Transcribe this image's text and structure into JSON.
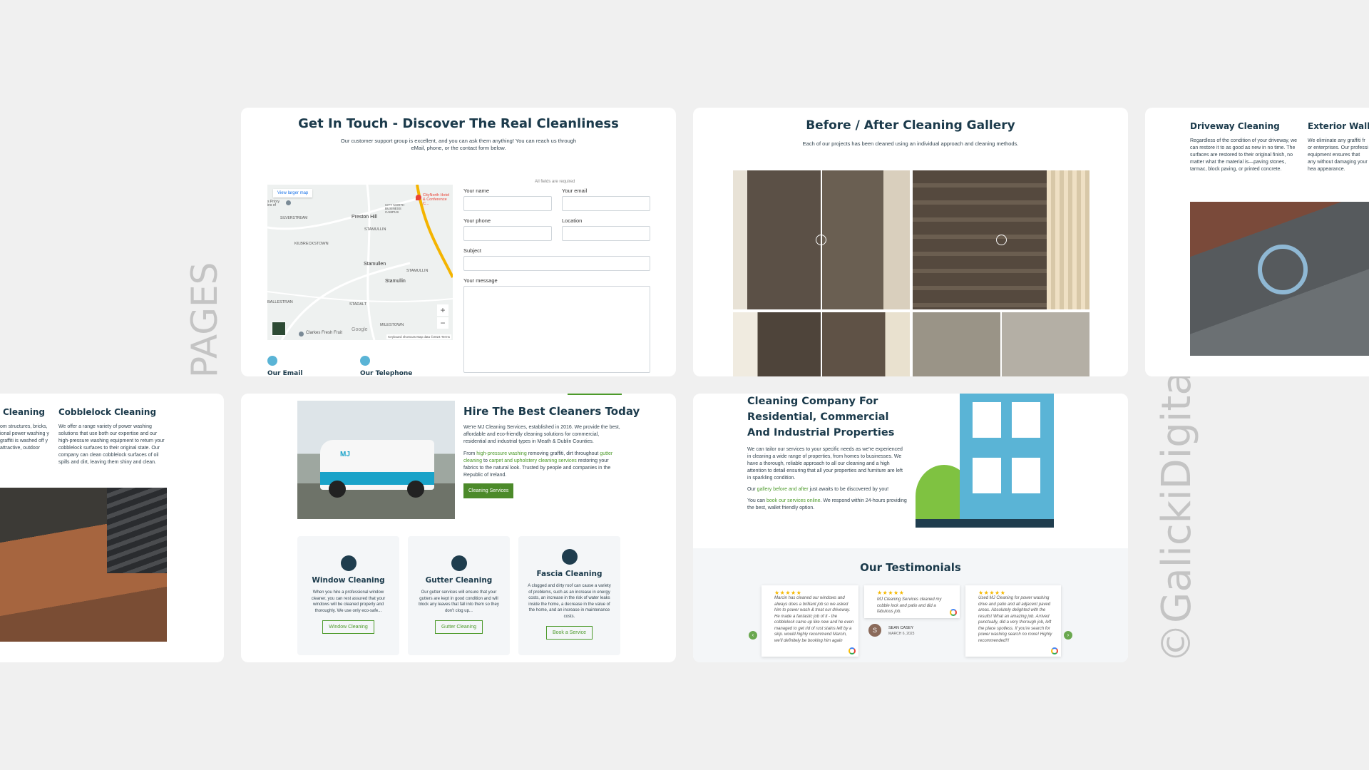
{
  "labels": {
    "pages": "PAGES",
    "watermark": "©GalickiDigital"
  },
  "contact": {
    "title": "Get In Touch - Discover The Real Cleanliness",
    "intro": "Our customer support group is excellent, and you can ask them anything! You can reach us through eMail, phone, or the contact form below.",
    "required_note": "All fields are required",
    "fields": {
      "name": "Your name",
      "email": "Your email",
      "phone": "Your phone",
      "location": "Location",
      "subject": "Subject",
      "message": "Your message"
    },
    "map": {
      "view_larger": "View larger map",
      "poi": "CityNorth Hotel & Conference C...",
      "places": [
        "Preston Hill",
        "STAMULLIN",
        "KILBRECKSTOWN",
        "Stamullen",
        "STAMULLIN",
        "Stamullin",
        "STADALT",
        "BALLESTRAN",
        "MILESTOWN",
        "Clarkes Fresh Fruit",
        "SILVERSTREAM",
        "CITY NORTH BUSINESS CAMPUS",
        "s Priory ins of"
      ],
      "zoom_in": "+",
      "zoom_out": "−",
      "footer": "Keyboard shortcuts   Map data ©2024   Terms",
      "brand": "Google"
    },
    "email_label": "Our Email",
    "phone_label": "Our Telephone"
  },
  "gallery": {
    "title": "Before / After Cleaning Gallery",
    "subtitle": "Each of our projects has been cleaned using an individual approach and cleaning methods."
  },
  "driveway": {
    "col1_title": "Driveway Cleaning",
    "col1_text": "Regardless of the condition of your driveway, we can restore it to as good as new in no time. The surfaces are restored to their original finish, no matter what the material is—paving stones, tarmac, block paving, or printed concrete.",
    "col2_title": "Exterior Walls",
    "col2_text": "We eliminate any graffiti fr or enterprises. Our professi equipment ensures that any without damaging your hea appearance."
  },
  "cobble": {
    "col1_title": "Cleaning",
    "col1_text": "om structures, bricks, ional power washing y graffiti is washed off y attractive, outdoor",
    "col2_title": "Cobblelock Cleaning",
    "col2_text": "We offer a range variety of power washing solutions that use both our expertise and our high-pressure washing equipment to return your cobblelock surfaces to their original state. Our company can clean cobblelock surfaces of oil spills and dirt, leaving them shiny and clean."
  },
  "hire": {
    "title": "Hire The Best Cleaners Today",
    "p1": "We're MJ Cleaning Services, established in 2016. We provide the best, affordable and eco-friendly cleaning solutions for commercial, residential and industrial types in Meath & Dublin Counties.",
    "p2_a": "From ",
    "p2_link1": "high-pressure washing",
    "p2_b": " removing graffiti, dirt throughout ",
    "p2_link2": "gutter cleaning",
    "p2_c": " to ",
    "p2_link3": "carpet and upholstery cleaning services",
    "p2_d": " restoring your fabrics to the natural look. Trusted by people and companies in the Republic of Ireland.",
    "button": "Cleaning Services",
    "van_logo": "MJ",
    "services": [
      {
        "title": "Window Cleaning",
        "text": "When you hire a professional window cleaner, you can rest assured that your windows will be cleaned properly and thoroughly. We use only eco-safe...",
        "button": "Window Cleaning"
      },
      {
        "title": "Gutter Cleaning",
        "text": "Our gutter services will ensure that your gutters are kept in good condition and will block any leaves that fall into them so they don't clog up...",
        "button": "Gutter Cleaning"
      },
      {
        "title": "Fascia Cleaning",
        "text": "A clogged and dirty roof can cause a variety of problems, such as an increase in energy costs, an increase in the risk of water leaks inside the home, a decrease in the value of the home, and an increase in maintenance costs.",
        "button": "Book a Service"
      }
    ]
  },
  "company": {
    "title": "Cleaning Company For Residential, Commercial And Industrial Properties",
    "p1": "We can tailor our services to your specific needs as we're experienced in cleaning a wide range of properties, from homes to businesses. We have a thorough, reliable approach to all our cleaning and a high attention to detail ensuring that all your properties and furniture are left in sparkling condition.",
    "p2_a": "Our ",
    "p2_link": "gallery before and after",
    "p2_b": " just awaits to be discovered by you!",
    "p3_a": "You can ",
    "p3_link": "book our services online",
    "p3_b": ". We respond within 24-hours providing the best, wallet friendly option.",
    "testimonials_title": "Our Testimonials",
    "reviews": [
      {
        "stars": "★★★★★",
        "text": "Marcin has cleaned our windows and always does a brilliant job so we asked him to power wash & treat our driveway. He made a fantastic job of it - the cobblelock came up like new and he even managed to get rid of rust stains left by a skip. would highly recommend Marcin, we'll definitely be booking him again"
      },
      {
        "stars": "★★★★★",
        "text": "MJ Cleaning Services cleaned my cobble lock and patio and did a fabulous job.",
        "author": "SEAN CASEY",
        "date": "MARCH 6, 2023",
        "initial": "S"
      },
      {
        "stars": "★★★★★",
        "text": "Used MJ Cleaning for power washing drive and patio and all adjacent paved areas. Absolutely delighted with the results! What an amazing job. Arrived punctually, did a very thorough job, left the place spotless. If you're search for power washing search no more! Highly recommended!!!"
      }
    ]
  }
}
